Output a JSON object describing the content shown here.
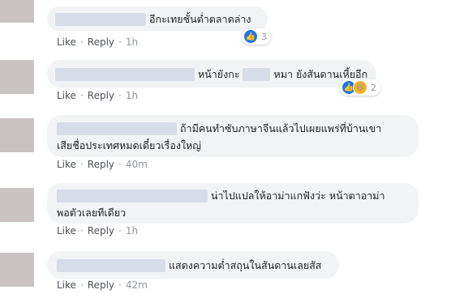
{
  "comments": [
    {
      "text": "อีกะเทยชั้นต่ำตลาดล่าง",
      "actions": {
        "like": "Like",
        "reply": "Reply",
        "time": "1h"
      },
      "reactions": {
        "count": "3",
        "types": [
          "like-icon"
        ]
      }
    },
    {
      "text_a": "หน้ายังกะ",
      "text_b": "หมา ยังสันดานเหี้ยอีก",
      "actions": {
        "like": "Like",
        "reply": "Reply",
        "time": "1h"
      },
      "reactions": {
        "count": "2",
        "types": [
          "like-icon",
          "haha-icon"
        ]
      }
    },
    {
      "line1": "ถ้ามีคนทำซับภาษาจีนแล้วไปเผยแพร่ที่บ้านเขา",
      "line2": "เสียชื่อประเทศหมดเดี๋ยวเรื่องใหญ่",
      "actions": {
        "like": "Like",
        "reply": "Reply",
        "time": "40m"
      }
    },
    {
      "line1": "น่าไปแปลให้อาม่าแกฟังว่ะ หน้าตาอาม่า",
      "line2": "พอตัวเลยทีเดียว",
      "actions": {
        "like": "Like",
        "reply": "Reply",
        "time": "1h"
      }
    },
    {
      "text": "แสดงความต่ำสถุนในสันดานเลยสัส",
      "actions": {
        "like": "Like",
        "reply": "Reply",
        "time": "42m"
      }
    }
  ],
  "separator": "·"
}
